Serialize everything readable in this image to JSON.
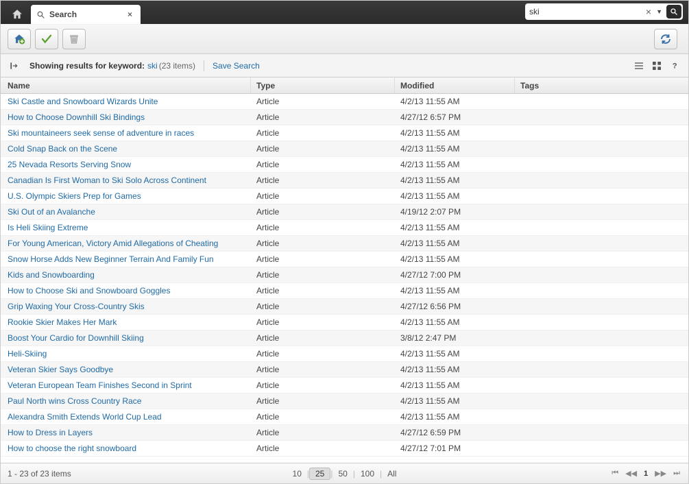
{
  "topbar": {
    "tab_label": "Search",
    "search_value": "ski"
  },
  "inforow": {
    "label": "Showing results for keyword:",
    "keyword": "ski",
    "count_text": "(23 items)",
    "save_search": "Save Search"
  },
  "columns": {
    "name": "Name",
    "type": "Type",
    "modified": "Modified",
    "tags": "Tags"
  },
  "rows": [
    {
      "name": "Ski Castle and Snowboard Wizards Unite",
      "type": "Article",
      "modified": "4/2/13 11:55 AM",
      "tags": ""
    },
    {
      "name": "How to Choose Downhill Ski Bindings",
      "type": "Article",
      "modified": "4/27/12 6:57 PM",
      "tags": ""
    },
    {
      "name": "Ski mountaineers seek sense of adventure in races",
      "type": "Article",
      "modified": "4/2/13 11:55 AM",
      "tags": ""
    },
    {
      "name": "Cold Snap Back on the Scene",
      "type": "Article",
      "modified": "4/2/13 11:55 AM",
      "tags": ""
    },
    {
      "name": "25 Nevada Resorts Serving Snow",
      "type": "Article",
      "modified": "4/2/13 11:55 AM",
      "tags": ""
    },
    {
      "name": "Canadian Is First Woman to Ski Solo Across Continent",
      "type": "Article",
      "modified": "4/2/13 11:55 AM",
      "tags": ""
    },
    {
      "name": "U.S. Olympic Skiers Prep for Games",
      "type": "Article",
      "modified": "4/2/13 11:55 AM",
      "tags": ""
    },
    {
      "name": "Ski Out of an Avalanche",
      "type": "Article",
      "modified": "4/19/12 2:07 PM",
      "tags": ""
    },
    {
      "name": "Is Heli Skiing Extreme",
      "type": "Article",
      "modified": "4/2/13 11:55 AM",
      "tags": ""
    },
    {
      "name": "For Young American, Victory Amid Allegations of Cheating",
      "type": "Article",
      "modified": "4/2/13 11:55 AM",
      "tags": ""
    },
    {
      "name": "Snow Horse Adds New Beginner Terrain And Family Fun",
      "type": "Article",
      "modified": "4/2/13 11:55 AM",
      "tags": ""
    },
    {
      "name": "Kids and Snowboarding",
      "type": "Article",
      "modified": "4/27/12 7:00 PM",
      "tags": ""
    },
    {
      "name": "How to Choose Ski and Snowboard Goggles",
      "type": "Article",
      "modified": "4/2/13 11:55 AM",
      "tags": ""
    },
    {
      "name": "Grip Waxing Your Cross-Country Skis",
      "type": "Article",
      "modified": "4/27/12 6:56 PM",
      "tags": ""
    },
    {
      "name": "Rookie Skier Makes Her Mark",
      "type": "Article",
      "modified": "4/2/13 11:55 AM",
      "tags": ""
    },
    {
      "name": "Boost Your Cardio for Downhill Skiing",
      "type": "Article",
      "modified": "3/8/12 2:47 PM",
      "tags": ""
    },
    {
      "name": "Heli-Skiing",
      "type": "Article",
      "modified": "4/2/13 11:55 AM",
      "tags": ""
    },
    {
      "name": "Veteran Skier Says Goodbye",
      "type": "Article",
      "modified": "4/2/13 11:55 AM",
      "tags": ""
    },
    {
      "name": "Veteran European Team Finishes Second in Sprint",
      "type": "Article",
      "modified": "4/2/13 11:55 AM",
      "tags": ""
    },
    {
      "name": "Paul North wins Cross Country Race",
      "type": "Article",
      "modified": "4/2/13 11:55 AM",
      "tags": ""
    },
    {
      "name": "Alexandra Smith Extends World Cup Lead",
      "type": "Article",
      "modified": "4/2/13 11:55 AM",
      "tags": ""
    },
    {
      "name": "How to Dress in Layers",
      "type": "Article",
      "modified": "4/27/12 6:59 PM",
      "tags": ""
    },
    {
      "name": "How to choose the right snowboard",
      "type": "Article",
      "modified": "4/27/12 7:01 PM",
      "tags": ""
    }
  ],
  "footer": {
    "range": "1 - 23 of 23 items",
    "sizes": [
      "10",
      "25",
      "50",
      "100",
      "All"
    ],
    "selected_size": "25",
    "current_page": "1"
  }
}
